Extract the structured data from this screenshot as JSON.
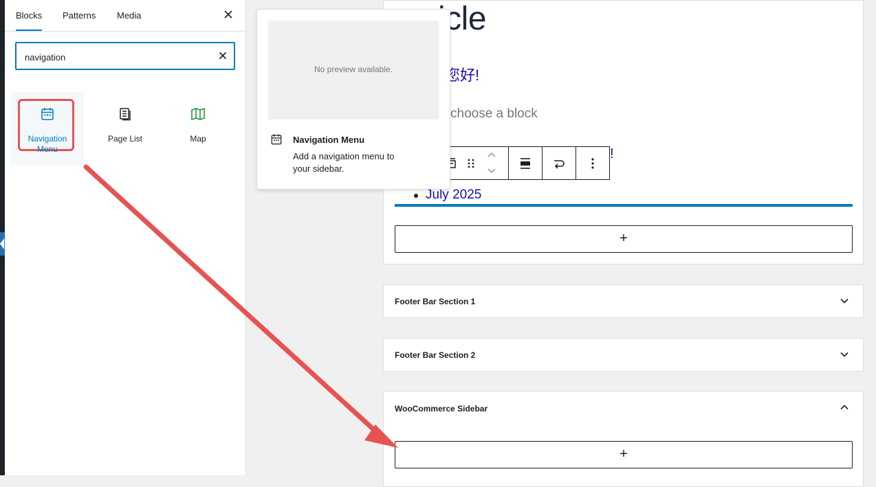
{
  "inserter": {
    "tabs": [
      {
        "label": "Blocks"
      },
      {
        "label": "Patterns"
      },
      {
        "label": "Media"
      }
    ],
    "search": {
      "value": "navigation"
    },
    "results": [
      {
        "label": "Navigation Menu",
        "icon": "calendar-icon"
      },
      {
        "label": "Page List",
        "icon": "page-list-icon"
      },
      {
        "label": "Map",
        "icon": "map-icon"
      }
    ]
  },
  "preview": {
    "no_preview": "No preview available.",
    "title": "Navigation Menu",
    "description": "Add a navigation menu to your sidebar."
  },
  "canvas": {
    "heading_partial": "icle",
    "hello_partial": "您好!",
    "placeholder_partial": "choose a block",
    "exclaim": "!",
    "archive_item": "July 2025",
    "add_symbol": "+",
    "sections": [
      {
        "title": "Footer Bar Section 1",
        "state": "collapsed"
      },
      {
        "title": "Footer Bar Section 2",
        "state": "collapsed"
      },
      {
        "title": "WooCommerce Sidebar",
        "state": "expanded"
      }
    ]
  },
  "colors": {
    "accent": "#007cba",
    "annotation": "#e55353",
    "link": "#1a0dab"
  }
}
